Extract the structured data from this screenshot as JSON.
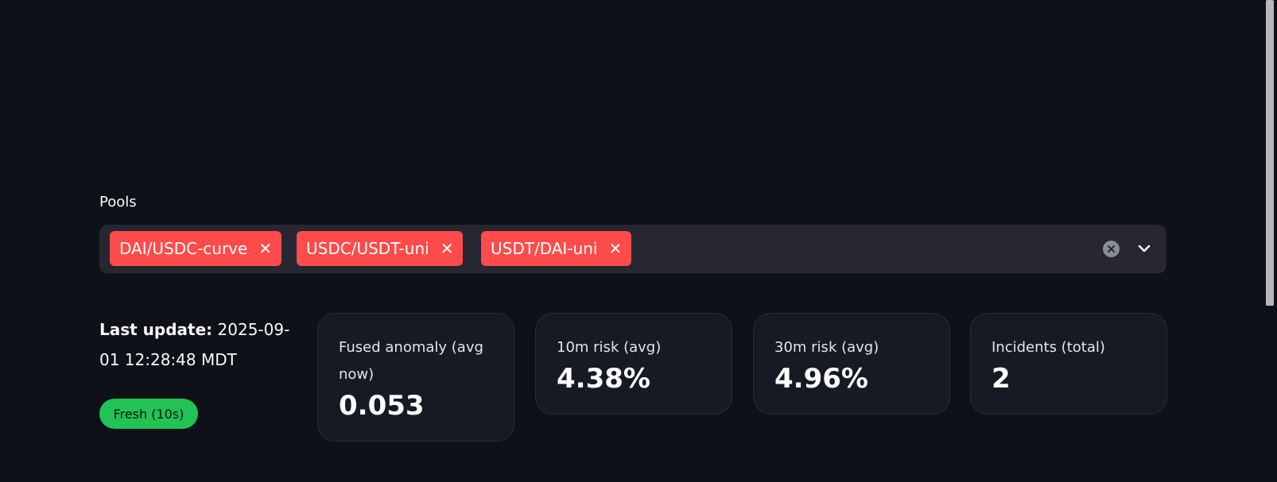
{
  "pools": {
    "label": "Pools",
    "selected": [
      {
        "name": "DAI/USDC-curve",
        "remove": "✕"
      },
      {
        "name": "USDC/USDT-uni",
        "remove": "✕"
      },
      {
        "name": "USDT/DAI-uni",
        "remove": "✕"
      }
    ],
    "tag_color": "#ff4b4b",
    "icons": {
      "clear": "clear-icon",
      "dropdown": "chevron-down-icon"
    }
  },
  "status": {
    "last_update_label": "Last update:",
    "last_update_value": "2025-09-01 12:28:48 MDT",
    "fresh_badge": "Fresh (10s)",
    "fresh_color": "#21c354"
  },
  "metrics": [
    {
      "label": "Fused anomaly (avg now)",
      "value": "0.053"
    },
    {
      "label": "10m risk (avg)",
      "value": "4.38%"
    },
    {
      "label": "30m risk (avg)",
      "value": "4.96%"
    },
    {
      "label": "Incidents (total)",
      "value": "2"
    }
  ]
}
